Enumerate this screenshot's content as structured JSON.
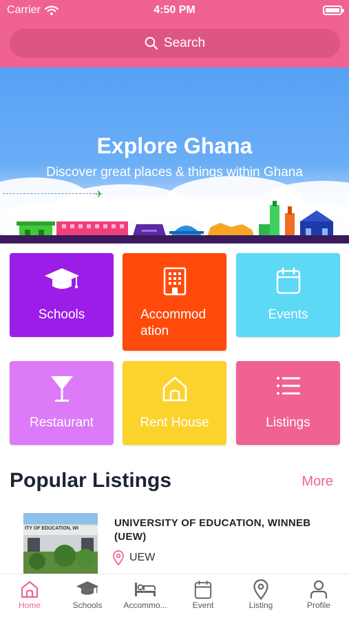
{
  "status_bar": {
    "carrier": "Carrier",
    "time": "4:50 PM"
  },
  "search": {
    "placeholder": "Search"
  },
  "hero": {
    "title": "Explore Ghana",
    "subtitle": "Discover great places & things within Ghana"
  },
  "categories": [
    {
      "label": "Schools",
      "icon": "graduation-cap-icon",
      "color": "#9c1de8"
    },
    {
      "label": "Accommod\nation",
      "icon": "building-icon",
      "color": "#ff4a0c"
    },
    {
      "label": "Events",
      "icon": "calendar-icon",
      "color": "#5dd8f5"
    },
    {
      "label": "Restaurant",
      "icon": "cocktail-icon",
      "color": "#dc7af7"
    },
    {
      "label": "Rent House",
      "icon": "house-icon",
      "color": "#fcd22c"
    },
    {
      "label": "Listings",
      "icon": "list-icon",
      "color": "#f06292"
    }
  ],
  "popular": {
    "title": "Popular Listings",
    "more_label": "More",
    "items": [
      {
        "name": "UNIVERSITY OF EDUCATION, WINNEB (UEW)",
        "location": "UEW",
        "image_sign": "ITY OF EDUCATION, WI"
      }
    ]
  },
  "tabs": [
    {
      "label": "Home",
      "icon": "home-icon",
      "active": true
    },
    {
      "label": "Schools",
      "icon": "graduation-cap-icon",
      "active": false
    },
    {
      "label": "Accommo...",
      "icon": "bed-icon",
      "active": false
    },
    {
      "label": "Event",
      "icon": "calendar-icon",
      "active": false
    },
    {
      "label": "Listing",
      "icon": "map-pin-icon",
      "active": false
    },
    {
      "label": "Profile",
      "icon": "person-icon",
      "active": false
    }
  ],
  "colors": {
    "primary": "#f06292",
    "sky": "#56a0f5",
    "heading": "#1c2434"
  }
}
